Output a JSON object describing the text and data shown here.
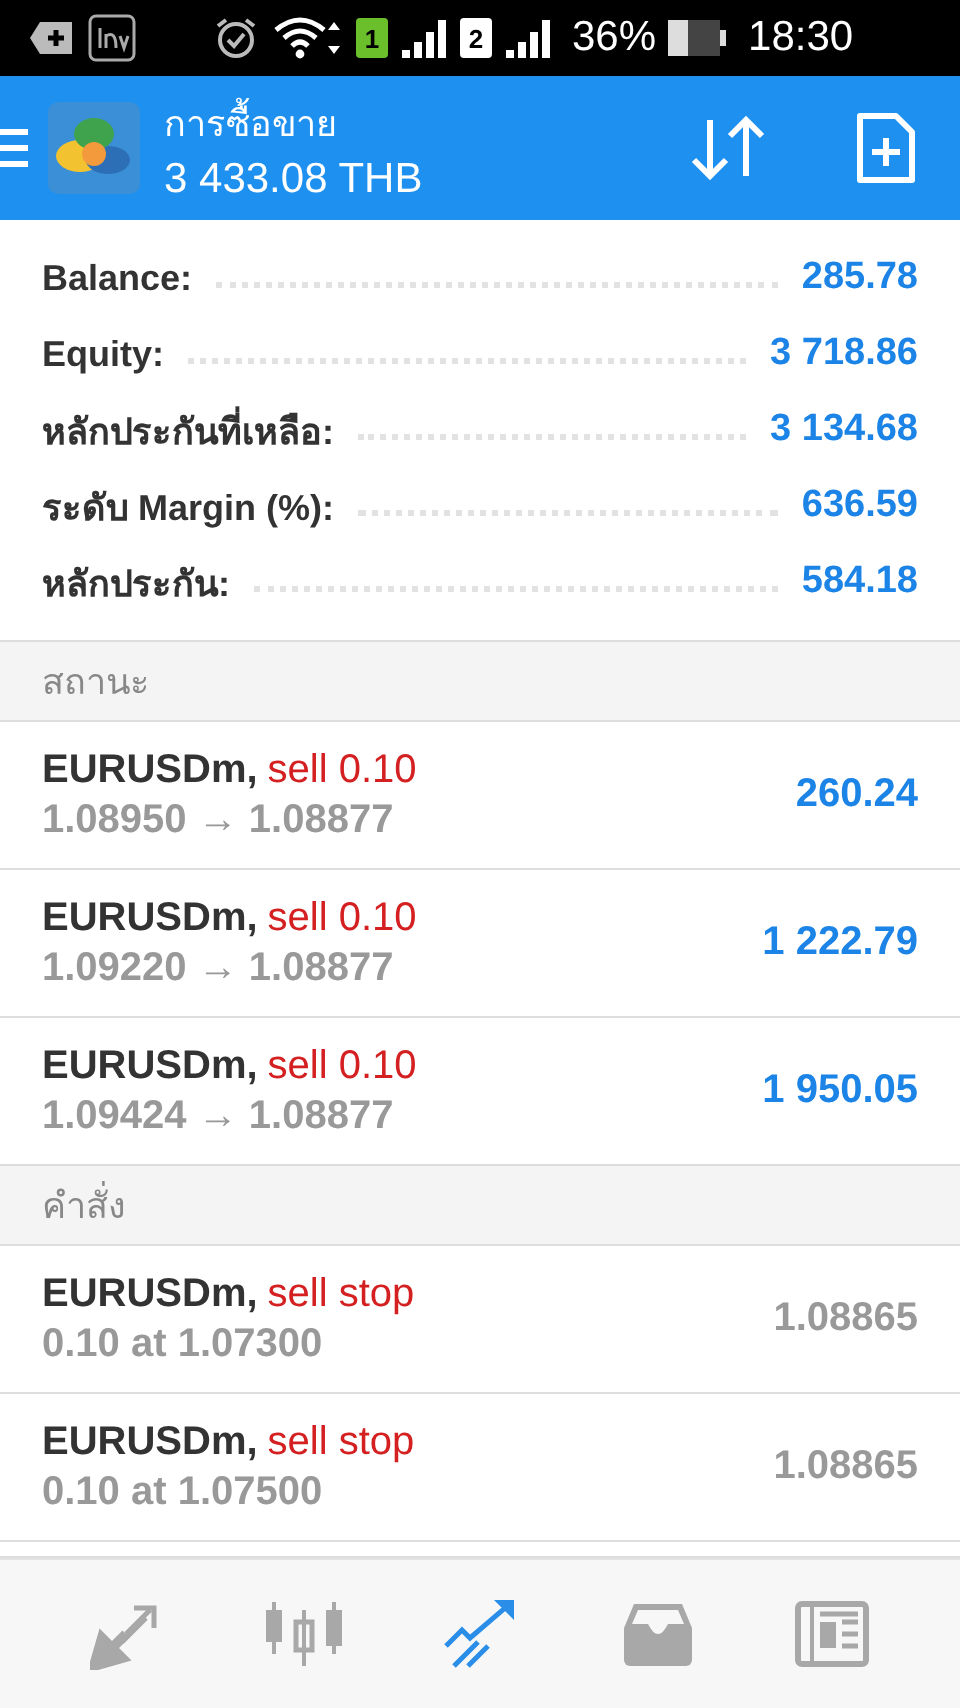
{
  "status_bar": {
    "sim_1": "1",
    "sim_2": "2",
    "battery": "36%",
    "time": "18:30"
  },
  "header": {
    "title": "การซื้อขาย",
    "balance": "3 433.08 THB"
  },
  "summary": [
    {
      "label": "Balance:",
      "value": "285.78"
    },
    {
      "label": "Equity:",
      "value": "3 718.86"
    },
    {
      "label": "หลักประกันที่เหลือ:",
      "value": "3 134.68"
    },
    {
      "label": "ระดับ Margin (%):",
      "value": "636.59"
    },
    {
      "label": "หลักประกัน:",
      "value": "584.18"
    }
  ],
  "sections": [
    {
      "title": "สถานะ",
      "rows": [
        {
          "kind": "position",
          "symbol": "EURUSDm,",
          "type": "sell 0.10",
          "detail": "1.08950 → 1.08877",
          "value": "260.24"
        },
        {
          "kind": "position",
          "symbol": "EURUSDm,",
          "type": "sell 0.10",
          "detail": "1.09220 → 1.08877",
          "value": "1 222.79"
        },
        {
          "kind": "position",
          "symbol": "EURUSDm,",
          "type": "sell 0.10",
          "detail": "1.09424 → 1.08877",
          "value": "1 950.05"
        }
      ]
    },
    {
      "title": "คำสั่ง",
      "rows": [
        {
          "kind": "order",
          "symbol": "EURUSDm,",
          "type": "sell stop",
          "detail": "0.10 at 1.07300",
          "value": "1.08865"
        },
        {
          "kind": "order",
          "symbol": "EURUSDm,",
          "type": "sell stop",
          "detail": "0.10 at 1.07500",
          "value": "1.08865"
        }
      ]
    }
  ],
  "nav": [
    {
      "kind": "quotes",
      "selected": false
    },
    {
      "kind": "chart",
      "selected": false
    },
    {
      "kind": "trade",
      "selected": true
    },
    {
      "kind": "history",
      "selected": false
    },
    {
      "kind": "news",
      "selected": false
    }
  ]
}
